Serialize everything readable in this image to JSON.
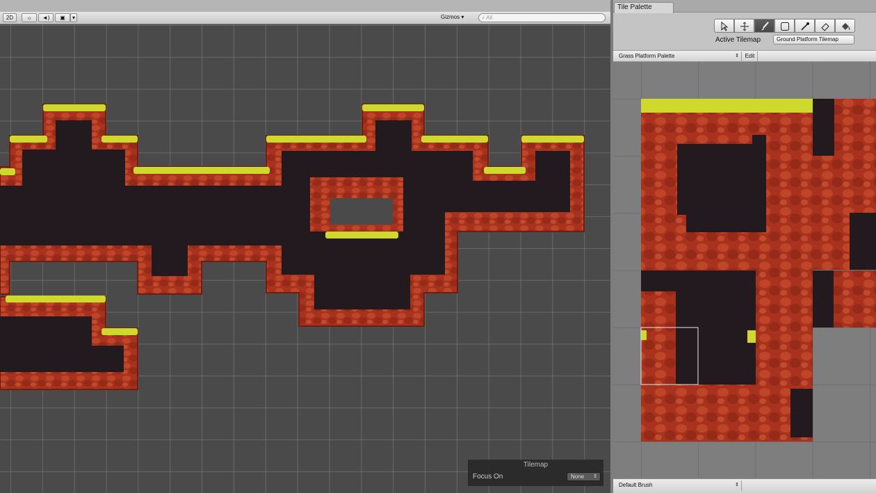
{
  "scene_toolbar": {
    "mode_2d": "2D",
    "gizmos_label": "Gizmos",
    "search_placeholder": "All"
  },
  "tilemap_overlay": {
    "title": "Tilemap",
    "focus_label": "Focus On",
    "focus_value": "None"
  },
  "tile_palette": {
    "tab_label": "Tile Palette",
    "tools": [
      "select-tool",
      "move-tool",
      "paint-brush-tool",
      "box-fill-tool",
      "picker-tool",
      "eraser-tool",
      "flood-fill-tool"
    ],
    "active_tool_index": 2,
    "active_tilemap_label": "Active Tilemap",
    "active_tilemap_value": "Ground Platform Tilemap",
    "palette_value": "Grass Platform Palette",
    "edit_label": "Edit",
    "brush_value": "Default Brush"
  },
  "colors": {
    "grass": "#cfd82c",
    "rock": "#a8321d",
    "rock_dark": "#6e1d12",
    "cave": "#221a1e",
    "scene_bg": "#4a4a4a"
  }
}
